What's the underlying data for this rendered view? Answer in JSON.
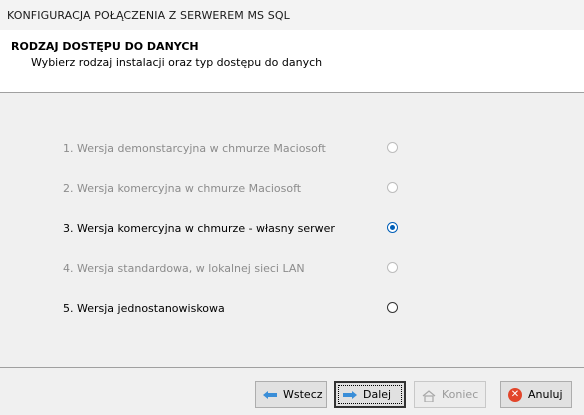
{
  "window": {
    "title": "KONFIGURACJA POŁĄCZENIA Z SERWEREM MS SQL"
  },
  "header": {
    "title": "RODZAJ DOSTĘPU DO DANYCH",
    "subtitle": "Wybierz rodzaj instalacji oraz typ dostępu do danych"
  },
  "options": [
    {
      "label": "1. Wersja demonstarcyjna w chmurze Maciosoft",
      "enabled": false,
      "selected": false
    },
    {
      "label": "2. Wersja komercyjna w chmurze Maciosoft",
      "enabled": false,
      "selected": false
    },
    {
      "label": "3. Wersja komercyjna w chmurze - własny serwer",
      "enabled": true,
      "selected": true
    },
    {
      "label": "4. Wersja standardowa, w lokalnej sieci LAN",
      "enabled": false,
      "selected": false
    },
    {
      "label": "5. Wersja jednostanowiskowa",
      "enabled": true,
      "selected": false
    }
  ],
  "footer": {
    "back_label": "Wstecz",
    "next_label": "Dalej",
    "finish_label": "Koniec",
    "cancel_label": "Anuluj"
  },
  "icons": {
    "back": "arrow-left-icon",
    "next": "arrow-right-icon",
    "finish": "home-icon",
    "cancel": "cancel-x-icon"
  },
  "colors": {
    "accent": "#005fb8",
    "disabled_text": "#8c8c8c",
    "cancel_red": "#e2452a"
  }
}
